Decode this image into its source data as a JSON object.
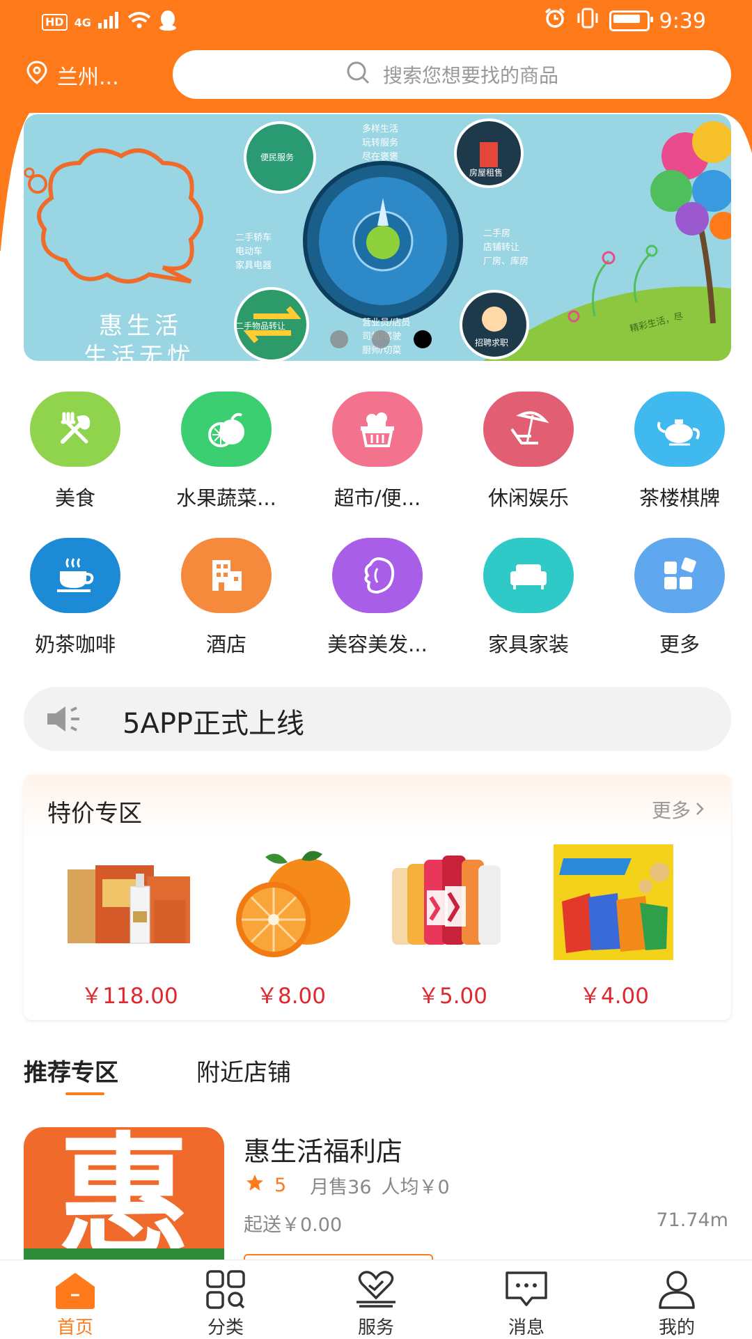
{
  "status_bar": {
    "network": "4G",
    "hd": "HD",
    "time": "9:39"
  },
  "header": {
    "location": "兰州...",
    "search_placeholder": "搜索您想要找的商品"
  },
  "banner": {
    "headline_1": "惠生活",
    "headline_2": "生活无忧",
    "items": [
      "便民服务",
      "房屋租售",
      "二手物品转让",
      "招聘求职"
    ],
    "texts": {
      "top": [
        "多样生活",
        "玩转服务",
        "尽在褒褒"
      ],
      "left": [
        "二手轿车",
        "电动车",
        "家具电器"
      ],
      "right": [
        "二手房",
        "店铺转让",
        "厂房、库房"
      ],
      "bottom": [
        "营业员/店员",
        "司机/驾驶",
        "厨师/切菜"
      ],
      "corner": "精彩生活，尽"
    },
    "page_count": 3,
    "active_index": 2
  },
  "categories": [
    {
      "label": "美食",
      "color": "#8fd44c",
      "icon": "fork-spoon-icon"
    },
    {
      "label": "水果蔬菜...",
      "color": "#3bcf72",
      "icon": "fruit-icon"
    },
    {
      "label": "超市/便...",
      "color": "#f3738f",
      "icon": "basket-icon"
    },
    {
      "label": "休闲娱乐",
      "color": "#e25f73",
      "icon": "beach-chair-icon"
    },
    {
      "label": "茶楼棋牌",
      "color": "#3fb9ee",
      "icon": "teapot-icon"
    },
    {
      "label": "奶茶咖啡",
      "color": "#1d8ad6",
      "icon": "coffee-cup-icon"
    },
    {
      "label": "酒店",
      "color": "#f58a3c",
      "icon": "hotel-icon"
    },
    {
      "label": "美容美发...",
      "color": "#a95ee8",
      "icon": "beauty-icon"
    },
    {
      "label": "家具家装",
      "color": "#2fcac7",
      "icon": "sofa-icon"
    },
    {
      "label": "更多",
      "color": "#5fa8ef",
      "icon": "more-grid-icon"
    }
  ],
  "notice": {
    "text": "5APP正式上线"
  },
  "special": {
    "title": "特价专区",
    "more": "更多",
    "products": [
      {
        "price": "￥118.00",
        "image": "liquor-gift-box"
      },
      {
        "price": "￥8.00",
        "image": "oranges"
      },
      {
        "price": "￥5.00",
        "image": "vitamin-water-bottles"
      },
      {
        "price": "￥4.00",
        "image": "potato-chips"
      }
    ]
  },
  "tabs": [
    "推荐专区",
    "附近店铺"
  ],
  "shop": {
    "logo_char": "惠",
    "name": "惠生活福利店",
    "rating": "5",
    "monthly_sales": "月售36",
    "avg_price": "人均￥0",
    "min_order": "起送￥0.00",
    "distance": "71.74m"
  },
  "nav": [
    {
      "label": "首页",
      "icon": "home-icon",
      "active": true
    },
    {
      "label": "分类",
      "icon": "category-icon",
      "active": false
    },
    {
      "label": "服务",
      "icon": "service-icon",
      "active": false
    },
    {
      "label": "消息",
      "icon": "message-icon",
      "active": false
    },
    {
      "label": "我的",
      "icon": "profile-icon",
      "active": false
    }
  ],
  "colors": {
    "brand": "#ff7a1a",
    "price": "#e0282e"
  }
}
